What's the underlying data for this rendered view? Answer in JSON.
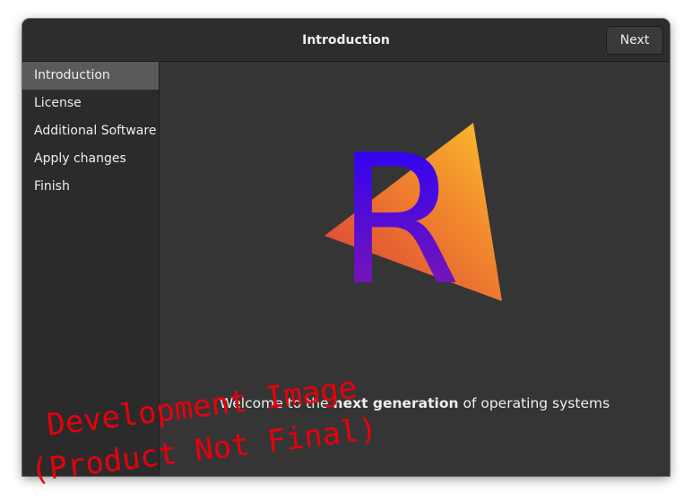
{
  "window": {
    "title": "Introduction",
    "next_label": "Next"
  },
  "sidebar": {
    "items": [
      {
        "label": "Introduction",
        "active": true
      },
      {
        "label": "License",
        "active": false
      },
      {
        "label": "Additional Software",
        "active": false
      },
      {
        "label": "Apply changes",
        "active": false
      },
      {
        "label": "Finish",
        "active": false
      }
    ]
  },
  "main": {
    "welcome_prefix": "Welcome to the ",
    "welcome_bold": "next generation",
    "welcome_suffix": " of operating systems",
    "logo_letter": "R"
  },
  "watermark": {
    "line1": "Development Image",
    "line2": "(Product Not Final)"
  },
  "colors": {
    "accent_red": "#e8000b",
    "logo_gradient_start": "#d8383b",
    "logo_gradient_end": "#fbc02d",
    "logo_letter_top": "#2200ff",
    "logo_letter_bottom": "#8a1aa8"
  }
}
